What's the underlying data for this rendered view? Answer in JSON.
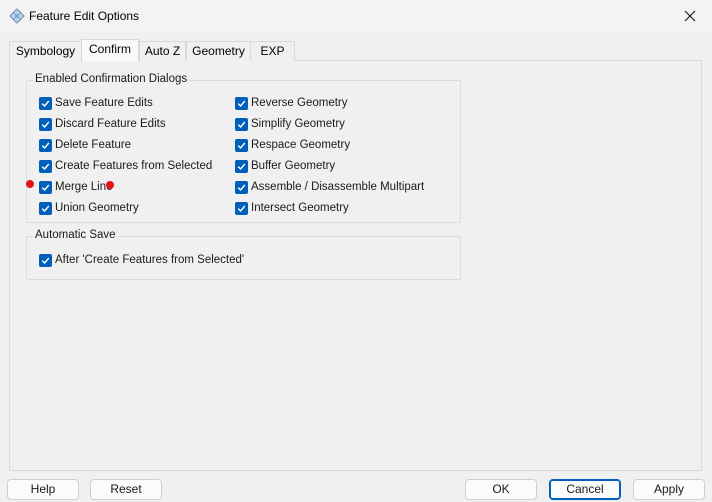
{
  "window": {
    "title": "Feature Edit Options",
    "app_icon": "diamond-grid-icon",
    "close_icon": "close-icon"
  },
  "tabs": [
    {
      "label": "Symbology",
      "active": false
    },
    {
      "label": "Confirm",
      "active": true
    },
    {
      "label": "Auto Z",
      "active": false
    },
    {
      "label": "Geometry",
      "active": false
    },
    {
      "label": "EXP",
      "active": false
    }
  ],
  "confirm": {
    "dialogs_group_title": "Enabled Confirmation Dialogs",
    "left_column": [
      {
        "label": "Save Feature Edits",
        "checked": true
      },
      {
        "label": "Discard Feature Edits",
        "checked": true
      },
      {
        "label": "Delete Feature",
        "checked": true
      },
      {
        "label": "Create Features from Selected",
        "checked": true
      },
      {
        "label": "Merge Line",
        "checked": true
      },
      {
        "label": "Union Geometry",
        "checked": true
      }
    ],
    "right_column": [
      {
        "label": "Reverse Geometry",
        "checked": true
      },
      {
        "label": "Simplify Geometry",
        "checked": true
      },
      {
        "label": "Respace Geometry",
        "checked": true
      },
      {
        "label": "Buffer Geometry",
        "checked": true
      },
      {
        "label": "Assemble / Disassemble Multipart",
        "checked": true
      },
      {
        "label": "Intersect Geometry",
        "checked": true
      }
    ],
    "autosave_group_title": "Automatic Save",
    "autosave_option": {
      "label": "After 'Create Features from Selected'",
      "checked": true
    }
  },
  "buttons": {
    "help": "Help",
    "reset": "Reset",
    "ok": "OK",
    "cancel": "Cancel",
    "apply": "Apply"
  },
  "colors": {
    "checkbox_accent": "#005fb8",
    "marker_red": "#e8101a"
  }
}
